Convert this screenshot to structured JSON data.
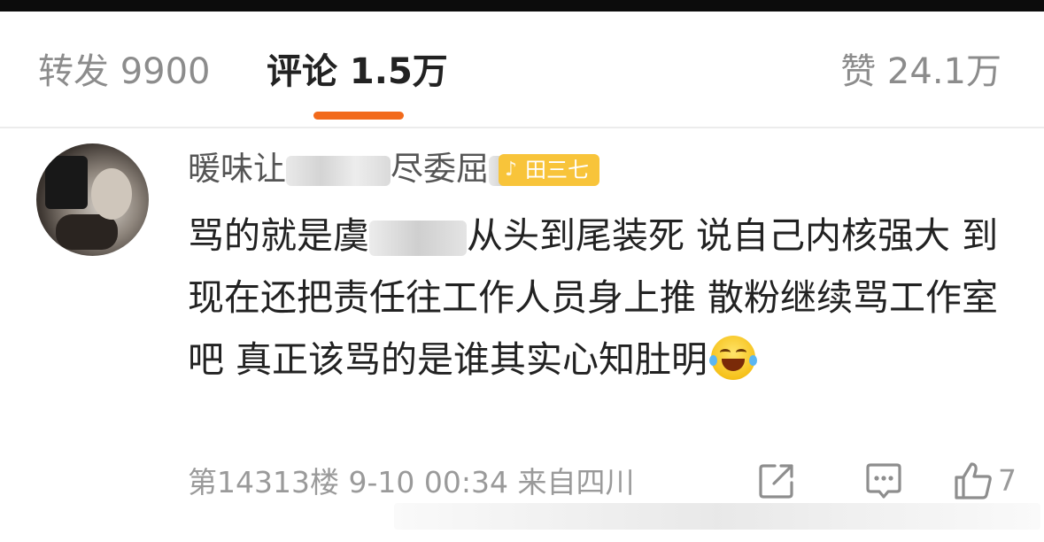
{
  "tabs": {
    "repost": "转发 9900",
    "comments": "评论 1.5万",
    "likes": "赞 24.1万",
    "active_color": "#f26a1b"
  },
  "comment": {
    "username_visible_1": "暖味让",
    "username_visible_2": "尽委屈",
    "badge_text": "田三七",
    "body_part_1": "骂的就是虞",
    "body_part_2": "从头到尾装死 说自己内核强大 到现在还把责任往工作人员身上推 散粉继续骂工作室吧 真正该骂的是谁其实心知肚明",
    "emoji": "laughing-with-tears",
    "meta": "第14313楼 9-10 00:34 来自四川",
    "like_count": "7"
  },
  "icons": {
    "share": "share-icon",
    "comment": "comment-icon",
    "like": "thumbs-up-icon"
  }
}
